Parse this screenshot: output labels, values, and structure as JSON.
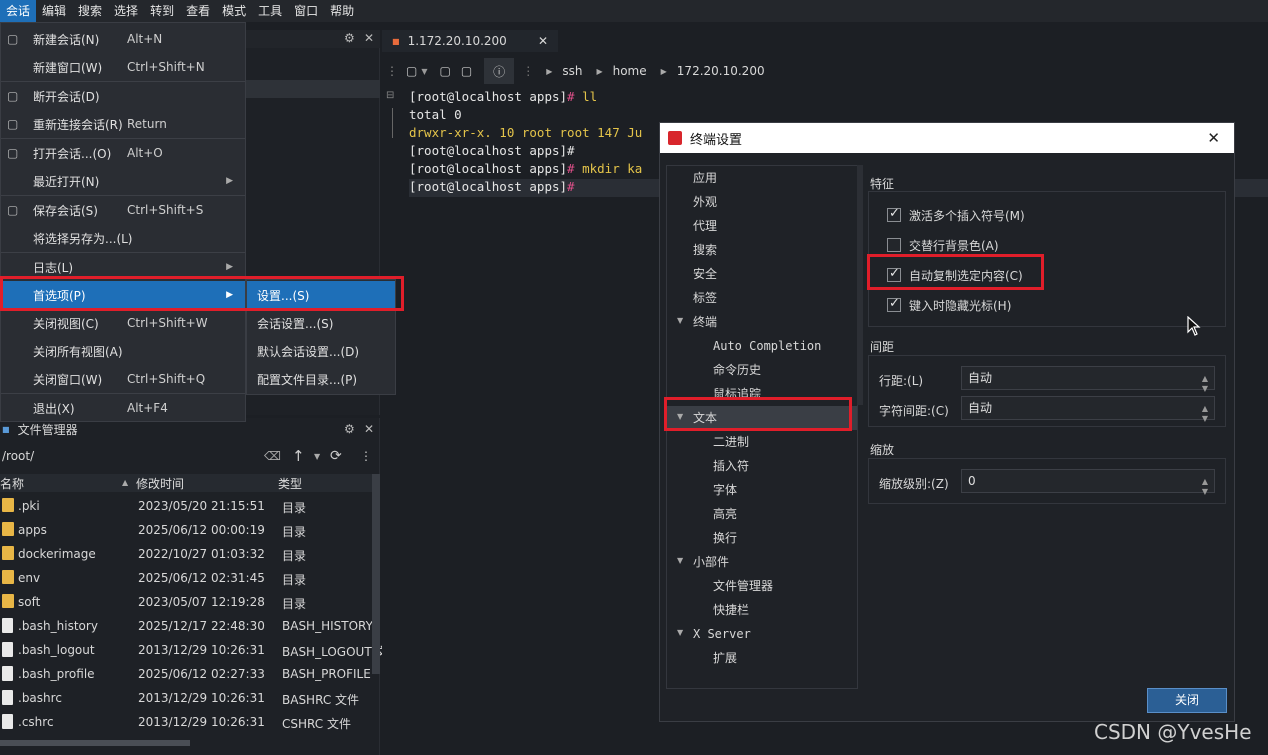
{
  "menubar": [
    "会话",
    "编辑",
    "搜索",
    "选择",
    "转到",
    "查看",
    "模式",
    "工具",
    "窗口",
    "帮助"
  ],
  "menu": [
    {
      "label": "新建会话(N)",
      "shortcut": "Alt+N",
      "icon": "new-session-icon"
    },
    {
      "label": "新建窗口(W)",
      "shortcut": "Ctrl+Shift+N"
    },
    {
      "label": "断开会话(D)",
      "shortcut": "",
      "icon": "disconnect-icon"
    },
    {
      "label": "重新连接会话(R)",
      "shortcut": "Return",
      "icon": "reconnect-icon"
    },
    {
      "label": "打开会话...(O)",
      "shortcut": "Alt+O",
      "icon": "open-session-icon"
    },
    {
      "label": "最近打开(N)",
      "shortcut": ""
    },
    {
      "label": "保存会话(S)",
      "shortcut": "Ctrl+Shift+S",
      "icon": "save-icon"
    },
    {
      "label": "将选择另存为...(L)",
      "shortcut": ""
    },
    {
      "label": "日志(L)",
      "shortcut": ""
    },
    {
      "label": "首选项(P)",
      "shortcut": ""
    },
    {
      "label": "关闭视图(C)",
      "shortcut": "Ctrl+Shift+W"
    },
    {
      "label": "关闭所有视图(A)",
      "shortcut": ""
    },
    {
      "label": "关闭窗口(W)",
      "shortcut": "Ctrl+Shift+Q"
    },
    {
      "label": "退出(X)",
      "shortcut": "Alt+F4"
    }
  ],
  "submenu": [
    "设置...(S)",
    "会话设置...(S)",
    "默认会话设置...(D)",
    "配置文件目录...(P)"
  ],
  "file_manager": {
    "title": "文件管理器",
    "path": "/root/",
    "columns": [
      "名称",
      "修改时间",
      "类型"
    ],
    "rows": [
      {
        "name": ".pki",
        "time": "2023/05/20 21:15:51",
        "type": "目录",
        "kind": "folder"
      },
      {
        "name": "apps",
        "time": "2025/06/12 00:00:19",
        "type": "目录",
        "kind": "folder"
      },
      {
        "name": "dockerimage",
        "time": "2022/10/27 01:03:32",
        "type": "目录",
        "kind": "folder"
      },
      {
        "name": "env",
        "time": "2025/06/12 02:31:45",
        "type": "目录",
        "kind": "folder"
      },
      {
        "name": "soft",
        "time": "2023/05/07 12:19:28",
        "type": "目录",
        "kind": "folder"
      },
      {
        "name": ".bash_history",
        "time": "2025/12/17 22:48:30",
        "type": "BASH_HISTORY",
        "kind": "file"
      },
      {
        "name": ".bash_logout",
        "time": "2013/12/29 10:26:31",
        "type": "BASH_LOGOUT 文",
        "kind": "file"
      },
      {
        "name": ".bash_profile",
        "time": "2025/06/12 02:27:33",
        "type": "BASH_PROFILE",
        "kind": "file"
      },
      {
        "name": ".bashrc",
        "time": "2013/12/29 10:26:31",
        "type": "BASHRC 文件",
        "kind": "file"
      },
      {
        "name": ".cshrc",
        "time": "2013/12/29 10:26:31",
        "type": "CSHRC 文件",
        "kind": "file"
      }
    ]
  },
  "tab": {
    "title": "1.172.20.10.200",
    "close": "✕"
  },
  "breadcrumb": [
    "ssh",
    "home",
    "172.20.10.200"
  ],
  "terminal": {
    "l1_prompt": "[root@localhost apps]",
    "l1_hash": "#",
    "l1_cmd": " ll",
    "l2": "total 0",
    "l3": "drwxr-xr-x. 10 root root 147 Ju",
    "l4": "[root@localhost apps]#",
    "l5_prompt": "[root@localhost apps]",
    "l5_hash": "#",
    "l5_cmd": " mkdir ka",
    "l6_prompt": "[root@localhost apps]",
    "l6_hash": "#"
  },
  "dialog": {
    "title": "终端设置",
    "close": "✕",
    "nav": {
      "top": [
        "应用",
        "外观",
        "代理",
        "搜索",
        "安全",
        "标签"
      ],
      "terminal": "终端",
      "terminal_children": [
        "Auto Completion",
        "命令历史",
        "鼠标追踪"
      ],
      "text": "文本",
      "text_children": [
        "二进制",
        "插入符",
        "字体",
        "高亮",
        "换行"
      ],
      "widgets": "小部件",
      "widgets_children": [
        "文件管理器",
        "快捷栏"
      ],
      "xserver": "X Server",
      "xserver_children": [
        "扩展"
      ]
    },
    "features_title": "特征",
    "features": [
      {
        "label": "激活多个插入符号(M)",
        "checked": true
      },
      {
        "label": "交替行背景色(A)",
        "checked": false
      },
      {
        "label": "自动复制选定内容(C)",
        "checked": true
      },
      {
        "label": "键入时隐藏光标(H)",
        "checked": true
      }
    ],
    "spacing_title": "间距",
    "line_spacing_label": "行距:(L)",
    "line_spacing_value": "自动",
    "char_spacing_label": "字符间距:(C)",
    "char_spacing_value": "自动",
    "zoom_title": "缩放",
    "zoom_label": "缩放级别:(Z)",
    "zoom_value": "0",
    "close_button": "关闭"
  },
  "watermark": "CSDN @YvesHe",
  "colors": {
    "accent": "#1e6fb8",
    "highlight": "#e01e2a",
    "prompt_hash": "#e0508a",
    "cmd": "#e4c44a"
  }
}
